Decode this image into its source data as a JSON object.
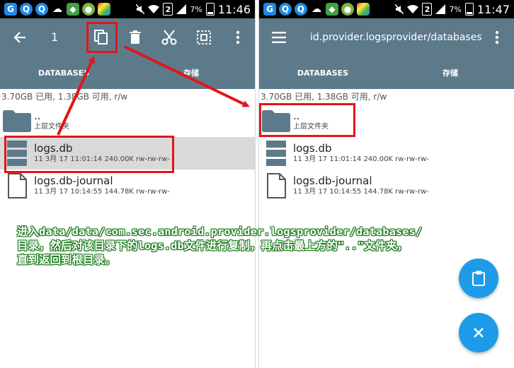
{
  "status_left": {
    "time": "11:46",
    "battery": "7%",
    "sim": "2"
  },
  "status_right": {
    "time": "11:47",
    "battery": "7%",
    "sim": "2"
  },
  "left": {
    "toolbar": {
      "selected_count": "1"
    },
    "tabs": [
      {
        "label": "DATABASES"
      },
      {
        "label": "存储"
      }
    ],
    "storage_info": "3.70GB 已用, 1.38GB 可用, r/w",
    "files": [
      {
        "name": "..",
        "meta": "上层文件夹",
        "type": "folder"
      },
      {
        "name": "logs.db",
        "meta": "11 3月 17 11:01:14  240.00K  rw-rw-rw-",
        "type": "db",
        "selected": true
      },
      {
        "name": "logs.db-journal",
        "meta": "11 3月 17 10:14:55  144.78K  rw-rw-rw-",
        "type": "file"
      }
    ]
  },
  "right": {
    "toolbar": {
      "title": "id.provider.logsprovider/databases"
    },
    "tabs": [
      {
        "label": "DATABASES"
      },
      {
        "label": "存储"
      }
    ],
    "storage_info": "3.70GB 已用, 1.38GB 可用, r/w",
    "files": [
      {
        "name": "..",
        "meta": "上层文件夹",
        "type": "folder"
      },
      {
        "name": "logs.db",
        "meta": "11 3月 17 11:01:14  240.00K  rw-rw-rw-",
        "type": "db"
      },
      {
        "name": "logs.db-journal",
        "meta": "11 3月 17 10:14:55  144.78K  rw-rw-rw-",
        "type": "file"
      }
    ]
  },
  "caption": {
    "line1": "进入data/data/com.sec.android.provider.logsprovider/databases/",
    "line2": "目录，然后对该目录下的logs.db文件进行复制，再点击最上方的\"..\"文件夹，",
    "line3": "直到返回到根目录。"
  },
  "colors": {
    "toolbar": "#5d7a8a",
    "fab": "#1e9be8",
    "highlight": "#e3151a",
    "caption_outline": "#1a7a1a"
  },
  "icons": {
    "toolbar_left": [
      "back-arrow-icon",
      "copy-icon",
      "delete-icon",
      "cut-icon",
      "select-all-icon",
      "more-vert-icon"
    ],
    "toolbar_right": [
      "menu-icon",
      "more-vert-icon"
    ],
    "fabs": [
      "clipboard-paste-icon",
      "close-icon"
    ]
  }
}
